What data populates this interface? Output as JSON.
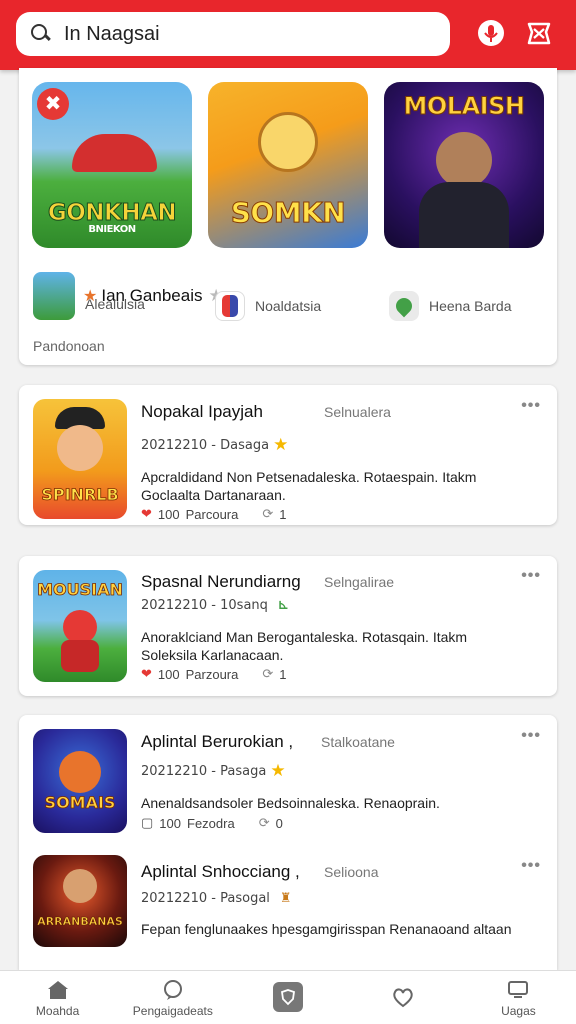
{
  "header": {
    "search_value": "In Naagsai",
    "accent_color": "#e8262c",
    "icons": [
      "search-icon",
      "mic-icon",
      "gift-icon"
    ]
  },
  "featured": {
    "games": [
      {
        "art_text": "GONKHAN",
        "sub_text": "BNIEKON"
      },
      {
        "art_text": "SOMKN",
        "sub_text": ""
      },
      {
        "art_text": "MOLAISH",
        "sub_text": ""
      }
    ],
    "app_title": "Ian Ganbeais",
    "mini_apps": [
      "Alealulsia",
      "Noaldatsia",
      "Heena Barda"
    ],
    "footer_text": "Pandonoan"
  },
  "apps": [
    {
      "title": "Nopakal Ipayjah",
      "tag": "Selnualera",
      "meta": "20212210 - Dasaga",
      "desc": "Apcraldidand Non Petsenadaleska. Rotaespain. Itakm Goclaalta Dartanaraan.",
      "likes": "100",
      "likes_label": "Parcoura",
      "shares": "1",
      "art_text": "SPINRLB"
    },
    {
      "title": "Spasnal Nerundiarng",
      "tag": "Selngalirae",
      "meta": "20212210 - 10sanq",
      "desc": "Anoraklciand Man Berogantaleska. Rotasqain. Itakm Soleksila Karlanacaan.",
      "likes": "100",
      "likes_label": "Parzoura",
      "shares": "1",
      "art_text": "MOUSIAN"
    },
    {
      "title": "Aplintal Berurokian ,",
      "tag": "Stalkoatane",
      "meta": "20212210 - Pasaga",
      "desc": "Anenaldsandsoler Bedsoinnaleska. Renaoprain.",
      "likes": "100",
      "likes_label": "Fezodra",
      "shares": "0",
      "art_text": "SOMAIS"
    },
    {
      "title": "Aplintal Snhocciang ,",
      "tag": "Selioona",
      "meta": "20212210 - Pasogal",
      "desc": "Fepan fenglunaakes hpesgamgirisspan Renanaoand altaan",
      "art_text": "ARRANBANAS"
    }
  ],
  "bottom_nav": [
    {
      "label": "Moahda",
      "icon": "home-icon"
    },
    {
      "label": "Pengaigadeats",
      "icon": "chat-icon"
    },
    {
      "label": "",
      "icon": "shield-icon"
    },
    {
      "label": "",
      "icon": "heart-icon"
    },
    {
      "label": "Uagas",
      "icon": "monitor-icon"
    }
  ]
}
